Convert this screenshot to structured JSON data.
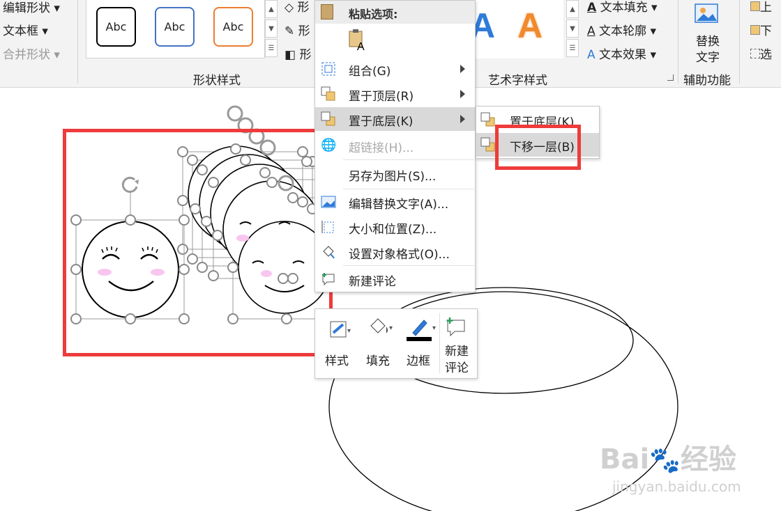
{
  "ribbon": {
    "left": {
      "edit_shape": "编辑形状",
      "text_box": "文本框",
      "merge_shapes": "合并形状"
    },
    "shape_gallery": [
      "Abc",
      "Abc",
      "Abc"
    ],
    "shape_fill_items": [
      "形",
      "形",
      "形"
    ],
    "shape_styles_label": "形状样式",
    "wordart_label": "艺术字样式",
    "text_fill": "文本填充",
    "text_outline": "文本轮廓",
    "text_effects": "文本效果",
    "alt_text_line1": "替换",
    "alt_text_line2": "文字",
    "accessibility_label": "辅助功能",
    "arrange": {
      "up": "上",
      "down": "下",
      "select": "选"
    }
  },
  "context_menu": {
    "paste_header": "粘贴选项:",
    "items": [
      {
        "label": "组合(G)",
        "submenu": true
      },
      {
        "label": "置于顶层(R)",
        "submenu": true
      },
      {
        "label": "置于底层(K)",
        "submenu": true
      },
      {
        "label": "超链接(H)...",
        "submenu": false
      },
      {
        "label": "另存为图片(S)...",
        "submenu": false
      },
      {
        "label": "编辑替换文字(A)...",
        "submenu": false
      },
      {
        "label": "大小和位置(Z)...",
        "submenu": false
      },
      {
        "label": "设置对象格式(O)...",
        "submenu": false
      },
      {
        "label": "新建评论",
        "submenu": false
      }
    ]
  },
  "submenu": {
    "items": [
      "置于底层(K)",
      "下移一层(B)"
    ]
  },
  "mini_toolbar": {
    "style": "样式",
    "fill": "填充",
    "border": "边框",
    "comment_line1": "新建",
    "comment_line2": "评论"
  },
  "watermark": {
    "brand": "Bai",
    "brand2": "经验",
    "url": "jingyan.baidu.com"
  },
  "colors": {
    "highlight_red": "#ee3b3b",
    "blush": "#f9c6f0",
    "wordart_blue": "#2f7bd8",
    "wordart_orange": "#f08a2c"
  }
}
